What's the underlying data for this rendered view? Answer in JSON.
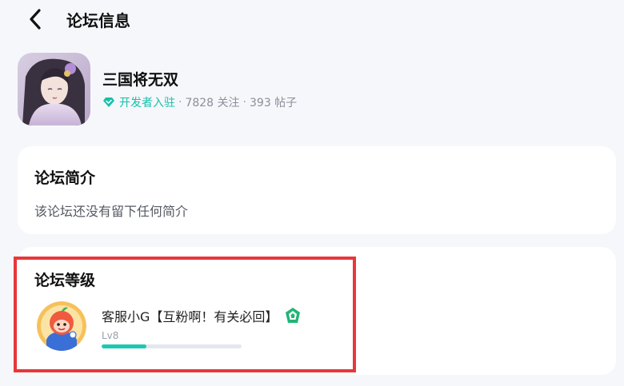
{
  "header": {
    "title": "论坛信息"
  },
  "forum": {
    "name": "三国将无双",
    "dev_badge": "开发者入驻",
    "sep": "·",
    "followers": "7828 关注",
    "posts": "393 帖子"
  },
  "intro": {
    "title": "论坛简介",
    "text": "该论坛还没有留下任何简介"
  },
  "level": {
    "title": "论坛等级",
    "moderator": {
      "name": "客服小G【互粉啊！有关必回】",
      "level": "Lv8",
      "progress": 0.32
    }
  },
  "colors": {
    "accent": "#1dc8b0",
    "highlight": "#e8373a",
    "badge": "#21b574"
  },
  "icons": {
    "back": "chevron-left-icon",
    "dev": "diamond-check-icon",
    "mod": "moderator-badge-icon"
  }
}
